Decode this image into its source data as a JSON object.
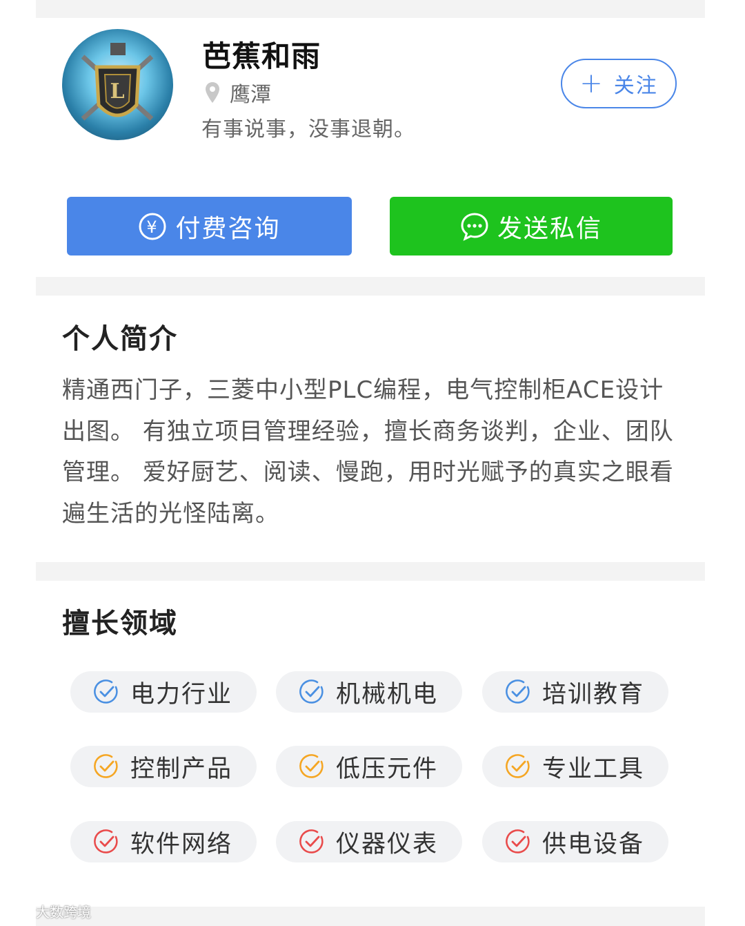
{
  "profile": {
    "name": "芭蕉和雨",
    "location": "鹰潭",
    "signature": "有事说事，没事退朝。",
    "follow_label": "关注",
    "follow_icon": "plus-icon",
    "location_icon": "location-pin-icon",
    "avatar_icon": "shield-emblem-avatar"
  },
  "actions": {
    "paid_consult_label": "付费咨询",
    "paid_consult_icon": "yen-circle-icon",
    "send_message_label": "发送私信",
    "send_message_icon": "chat-bubble-icon"
  },
  "intro": {
    "title": "个人简介",
    "text": "精通西门子，三菱中小型PLC编程，电气控制柜ACE设计出图。 有独立项目管理经验，擅长商务谈判，企业、团队管理。 爱好厨艺、阅读、慢跑，用时光赋予的真实之眼看遍生活的光怪陆离。"
  },
  "skills": {
    "title": "擅长领域",
    "tags": [
      {
        "label": "电力行业",
        "color": "#4a90e2"
      },
      {
        "label": "机械机电",
        "color": "#4a90e2"
      },
      {
        "label": "培训教育",
        "color": "#4a90e2"
      },
      {
        "label": "控制产品",
        "color": "#f5a623"
      },
      {
        "label": "低压元件",
        "color": "#f5a623"
      },
      {
        "label": "专业工具",
        "color": "#f5a623"
      },
      {
        "label": "软件网络",
        "color": "#e94b4b"
      },
      {
        "label": "仪器仪表",
        "color": "#e94b4b"
      },
      {
        "label": "供电设备",
        "color": "#e94b4b"
      }
    ]
  },
  "colors": {
    "primary_blue": "#4a86e8",
    "green": "#1ec31e",
    "band_gray": "#f3f3f3"
  },
  "watermark": {
    "text": "大数跨境"
  }
}
